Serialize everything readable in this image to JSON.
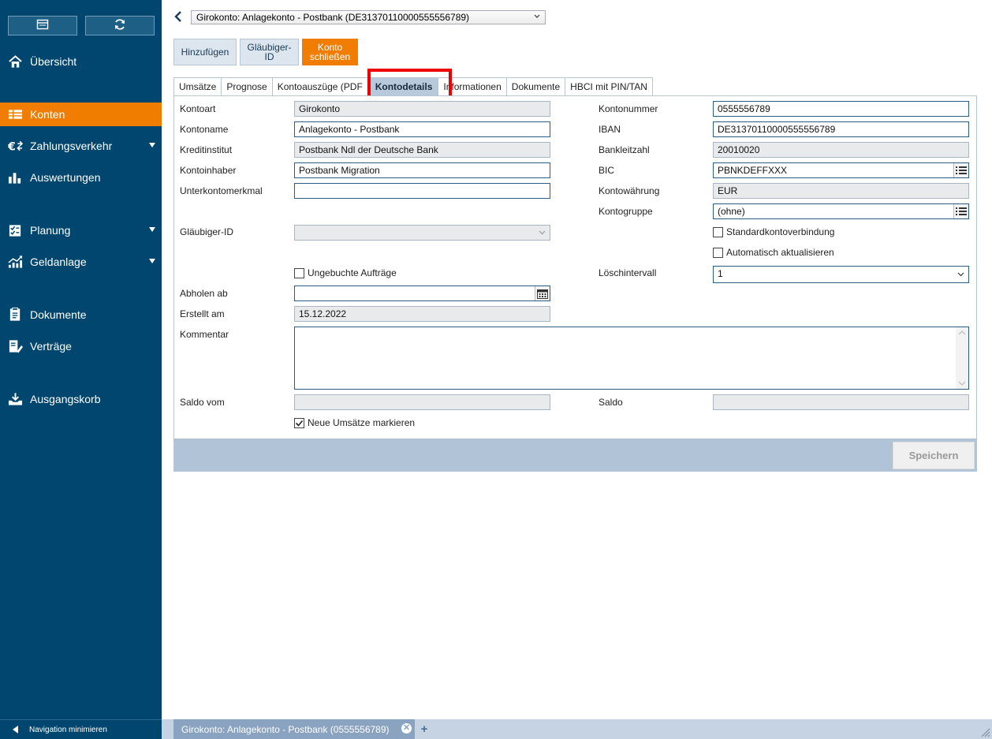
{
  "sidebar": {
    "top_buttons": [
      {
        "icon": "window-icon"
      },
      {
        "icon": "refresh-icon"
      }
    ],
    "items": [
      {
        "label": "Übersicht",
        "icon": "home-icon"
      },
      {
        "label": "Konten",
        "icon": "accounts-icon",
        "active": true
      },
      {
        "label": "Zahlungsverkehr",
        "icon": "euro-transfer-icon",
        "expandable": true
      },
      {
        "label": "Auswertungen",
        "icon": "bar-chart-icon"
      },
      {
        "label": "Planung",
        "icon": "planning-icon",
        "expandable": true
      },
      {
        "label": "Geldanlage",
        "icon": "growth-chart-icon",
        "expandable": true
      },
      {
        "label": "Dokumente",
        "icon": "documents-icon"
      },
      {
        "label": "Verträge",
        "icon": "contracts-icon"
      },
      {
        "label": "Ausgangskorb",
        "icon": "outbox-icon"
      }
    ],
    "minimize_label": "Navigation minimieren"
  },
  "header": {
    "account_select": "Girokonto: Anlagekonto - Postbank (DE31370110000555556789)",
    "buttons": {
      "add": "Hinzufügen",
      "creditor_line1": "Gläubiger-",
      "creditor_line2": "ID",
      "close_line1": "Konto",
      "close_line2": "schließen"
    }
  },
  "tabs": [
    "Umsätze",
    "Prognose",
    "Kontoauszüge (PDF",
    "Kontodetails",
    "Informationen",
    "Dokumente",
    "HBCI mit PIN/TAN"
  ],
  "active_tab": "Kontodetails",
  "form": {
    "labels": {
      "kontoart": "Kontoart",
      "kontoname": "Kontoname",
      "kreditinstitut": "Kreditinstitut",
      "kontoinhaber": "Kontoinhaber",
      "unterkontomerkmal": "Unterkontomerkmal",
      "glaeubiger_id": "Gläubiger-ID",
      "abholen_ab": "Abholen ab",
      "erstellt_am": "Erstellt am",
      "kommentar": "Kommentar",
      "saldo_vom": "Saldo vom",
      "kontonummer": "Kontonummer",
      "iban": "IBAN",
      "bankleitzahl": "Bankleitzahl",
      "bic": "BIC",
      "kontowaehrung": "Kontowährung",
      "kontogruppe": "Kontogruppe",
      "loeschintervall": "Löschintervall",
      "saldo": "Saldo"
    },
    "values": {
      "kontoart": "Girokonto",
      "kontoname": "Anlagekonto - Postbank",
      "kreditinstitut": "Postbank Ndl der Deutsche Bank",
      "kontoinhaber": "Postbank Migration",
      "unterkontomerkmal": "",
      "glaeubiger_id": "",
      "abholen_ab": "",
      "erstellt_am": "15.12.2022",
      "kommentar": "",
      "saldo_vom": "",
      "kontonummer": "0555556789",
      "iban": "DE31370110000555556789",
      "bankleitzahl": "20010020",
      "bic": "PBNKDEFFXXX",
      "kontowaehrung": "EUR",
      "kontogruppe": "(ohne)",
      "loeschintervall": "1",
      "saldo": ""
    },
    "checkboxes": {
      "ungebuchte": {
        "label": "Ungebuchte Aufträge",
        "checked": false
      },
      "standard": {
        "label": "Standardkontoverbindung",
        "checked": false
      },
      "auto_update": {
        "label": "Automatisch aktualisieren",
        "checked": false
      },
      "neue_umsaetze": {
        "label": "Neue Umsätze markieren",
        "checked": true
      }
    },
    "save_label": "Speichern"
  },
  "bottom_tab": {
    "label": "Girokonto: Anlagekonto - Postbank (0555556789)",
    "close": "✕",
    "add": "+"
  }
}
